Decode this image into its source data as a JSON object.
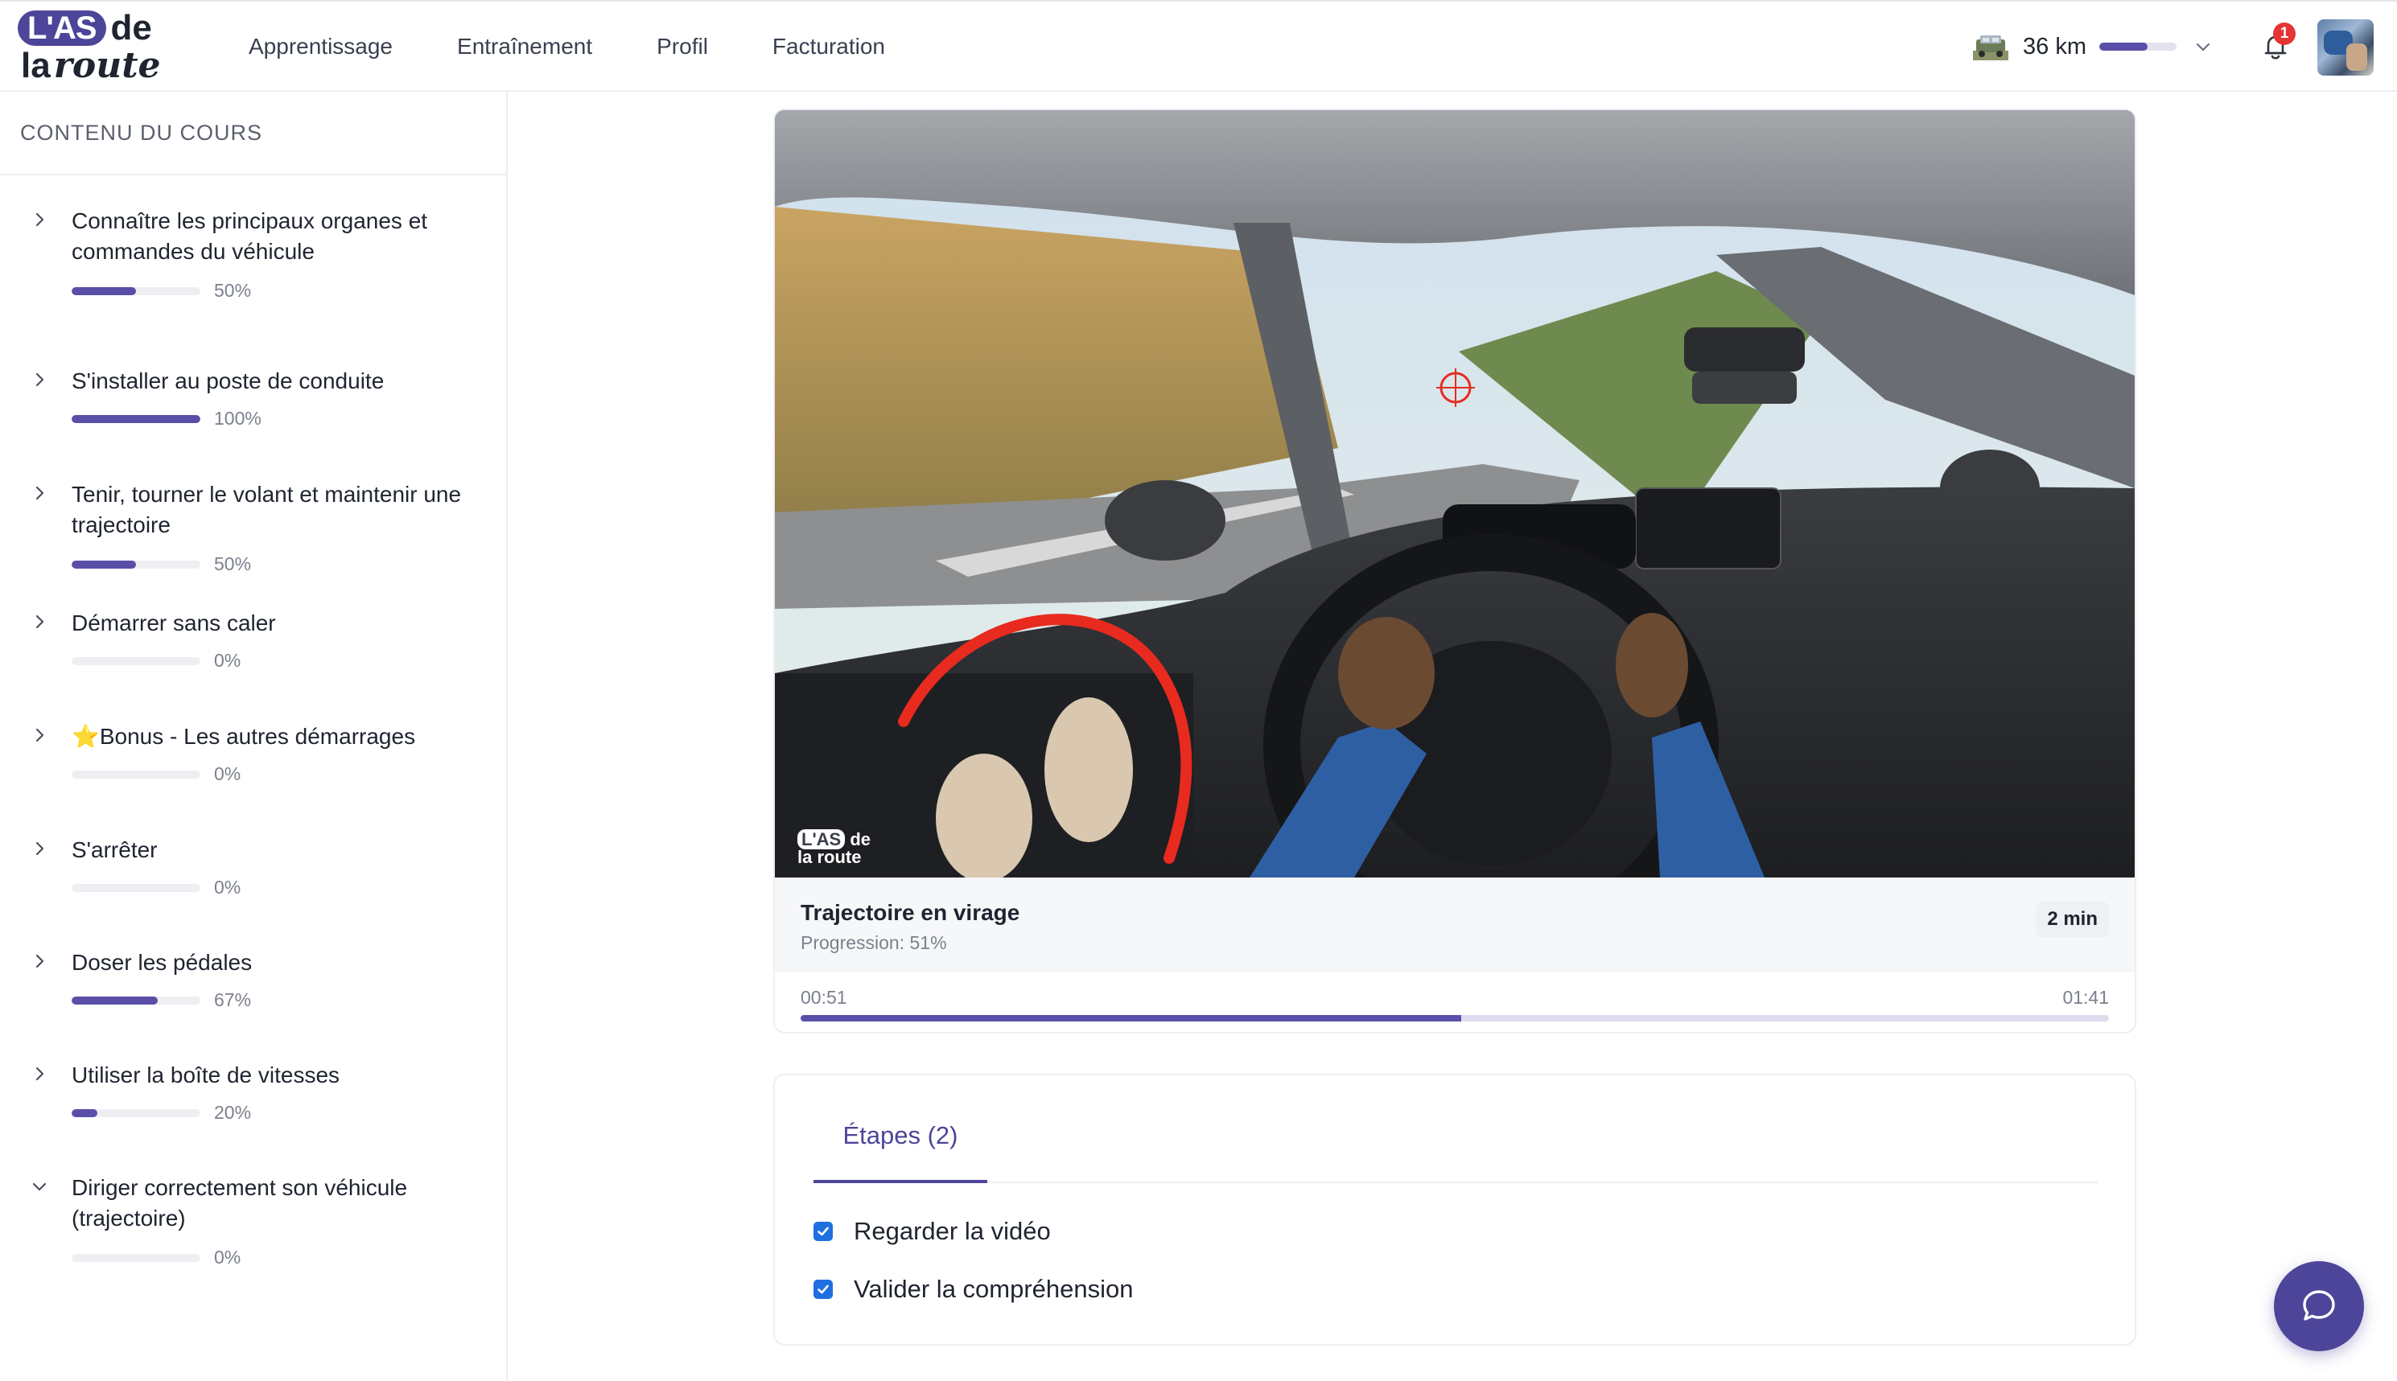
{
  "brand": {
    "logo_top": "L'AS",
    "logo_de": "de",
    "logo_la": "la",
    "logo_route": "route",
    "accent": "#4d4599"
  },
  "nav": {
    "items": [
      "Apprentissage",
      "Entraînement",
      "Profil",
      "Facturation"
    ]
  },
  "header": {
    "km_label": "36 km",
    "km_progress": 0.62,
    "notifications_count": "1",
    "icons": [
      "car-icon",
      "chevron-down-icon",
      "bell-icon",
      "avatar"
    ]
  },
  "sidebar": {
    "title": "CONTENU DU COURS",
    "modules": [
      {
        "title": "Connaître les principaux organes et commandes du véhicule",
        "percent_label": "50%",
        "progress": 0.5,
        "expanded": false
      },
      {
        "title": "S'installer au poste de conduite",
        "percent_label": "100%",
        "progress": 1.0,
        "expanded": false
      },
      {
        "title": "Tenir, tourner le volant et maintenir une trajectoire",
        "percent_label": "50%",
        "progress": 0.5,
        "expanded": false
      },
      {
        "title": "Démarrer sans caler",
        "percent_label": "0%",
        "progress": 0,
        "expanded": false
      },
      {
        "title": "⭐Bonus - Les autres démarrages",
        "percent_label": "0%",
        "progress": 0,
        "expanded": false
      },
      {
        "title": "S'arrêter",
        "percent_label": "0%",
        "progress": 0,
        "expanded": false
      },
      {
        "title": "Doser les pédales",
        "percent_label": "67%",
        "progress": 0.67,
        "expanded": false
      },
      {
        "title": "Utiliser la boîte de vitesses",
        "percent_label": "20%",
        "progress": 0.2,
        "expanded": false
      },
      {
        "title": "Diriger correctement son véhicule (trajectoire)",
        "percent_label": "0%",
        "progress": 0,
        "expanded": true
      }
    ]
  },
  "video": {
    "watermark_top": "L'AS",
    "watermark_de": "de",
    "watermark_bottom": "la route",
    "title": "Trajectoire en virage",
    "progress_label": "Progression: 51%",
    "duration": "2 min",
    "current_time": "00:51",
    "total_time": "01:41",
    "timeline_progress": 0.505
  },
  "steps": {
    "tab_label": "Étapes (2)",
    "items": [
      {
        "label": "Regarder la vidéo",
        "checked": true
      },
      {
        "label": "Valider la compréhension",
        "checked": true
      }
    ],
    "checkbox_color": "#1f6fe0"
  },
  "chat": {
    "icon": "chat-bubble-icon"
  }
}
